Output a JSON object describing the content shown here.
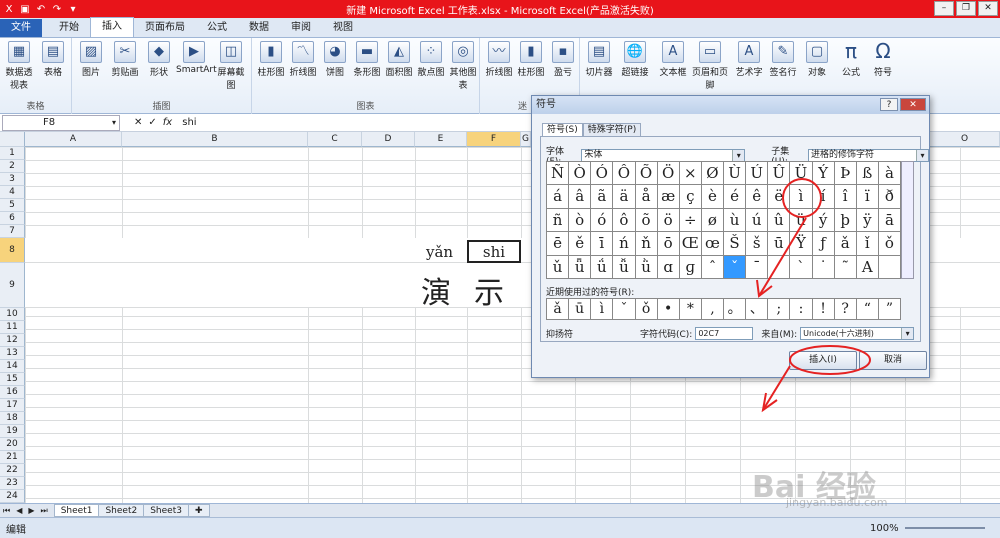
{
  "title": "新建 Microsoft Excel 工作表.xlsx - Microsoft Excel(产品激活失败)",
  "tabs": [
    "文件",
    "开始",
    "插入",
    "页面布局",
    "公式",
    "数据",
    "审阅",
    "视图"
  ],
  "ribbon": {
    "groups": [
      {
        "label": "表格",
        "buttons": [
          "数据透视表",
          "表格"
        ]
      },
      {
        "label": "插图",
        "buttons": [
          "图片",
          "剪贴画",
          "形状",
          "SmartArt",
          "屏幕截图"
        ]
      },
      {
        "label": "图表",
        "buttons": [
          "柱形图",
          "折线图",
          "饼图",
          "条形图",
          "面积图",
          "散点图",
          "其他图表"
        ]
      },
      {
        "label": "迷",
        "buttons": [
          "折线图",
          "柱形图",
          "盈亏"
        ]
      },
      {
        "label": "",
        "buttons": [
          "切片器",
          "超链接",
          "文本框",
          "页眉和页脚",
          "艺术字",
          "签名行",
          "对象",
          "公式",
          "符号"
        ]
      }
    ]
  },
  "formula_bar": {
    "namebox": "F8",
    "value": "shi",
    "fx": "fx"
  },
  "columns": [
    "A",
    "B",
    "C",
    "D",
    "E",
    "F",
    "G",
    "O"
  ],
  "rows": [
    "1",
    "2",
    "3",
    "4",
    "5",
    "6",
    "7",
    "8",
    "9",
    "10",
    "11",
    "12",
    "13",
    "14",
    "15",
    "16",
    "17",
    "18",
    "19",
    "20",
    "21",
    "22",
    "23",
    "24"
  ],
  "cells": {
    "pinyin1": "yǎn",
    "pinyin2": "shi",
    "han1": "演",
    "han2": "示"
  },
  "sheets": [
    "Sheet1",
    "Sheet2",
    "Sheet3"
  ],
  "status": {
    "mode": "编辑",
    "zoom": "100%"
  },
  "dialog": {
    "title": "符号",
    "tab1": "符号(S)",
    "tab2": "特殊字符(P)",
    "font_label": "字体(F):",
    "font_value": "宋体",
    "subset_label": "子集(U):",
    "subset_value": "进格的修饰字符",
    "grid": [
      [
        "Ñ",
        "Ò",
        "Ó",
        "Ô",
        "Õ",
        "Ö",
        "×",
        "Ø",
        "Ù",
        "Ú",
        "Û",
        "Ü",
        "Ý",
        "Þ",
        "ß",
        "à"
      ],
      [
        "á",
        "â",
        "ã",
        "ä",
        "å",
        "æ",
        "ç",
        "è",
        "é",
        "ê",
        "ë",
        "ì",
        "í",
        "î",
        "ï",
        "ð"
      ],
      [
        "ñ",
        "ò",
        "ó",
        "ô",
        "õ",
        "ö",
        "÷",
        "ø",
        "ù",
        "ú",
        "û",
        "ü",
        "ý",
        "þ",
        "ÿ",
        "ā"
      ],
      [
        "ē",
        "ě",
        "ī",
        "ń",
        "ň",
        "ō",
        "Œ",
        "œ",
        "Š",
        "š",
        "ū",
        "Ÿ",
        "ƒ",
        "ǎ",
        "ǐ",
        "ǒ"
      ],
      [
        "ǔ",
        "ǖ",
        "ǘ",
        "ǚ",
        "ǜ",
        "ɑ",
        "ɡ",
        "ˆ",
        "ˇ",
        "ˉ",
        "ˊ",
        "ˋ",
        "˙",
        "˜",
        "A",
        ""
      ]
    ],
    "recent_label": "近期使用过的符号(R):",
    "recent": [
      "ǎ",
      "ū",
      "ì",
      "ˇ",
      "ǒ",
      "•",
      "*",
      ",",
      "。",
      "、",
      ";",
      ":",
      "!",
      "?",
      "“",
      "”"
    ],
    "char_name": "抑扬符",
    "code_label": "字符代码(C):",
    "code_value": "02C7",
    "from_label": "来自(M):",
    "from_value": "Unicode(十六进制)",
    "insert": "插入(I)",
    "cancel": "取消"
  },
  "watermark": "Bai 经验",
  "watermark_url": "jingyan.baidu.com",
  "colors": {
    "titlebar": "#e8141a",
    "annotation": "#e52222",
    "selected": "#3399ff"
  }
}
